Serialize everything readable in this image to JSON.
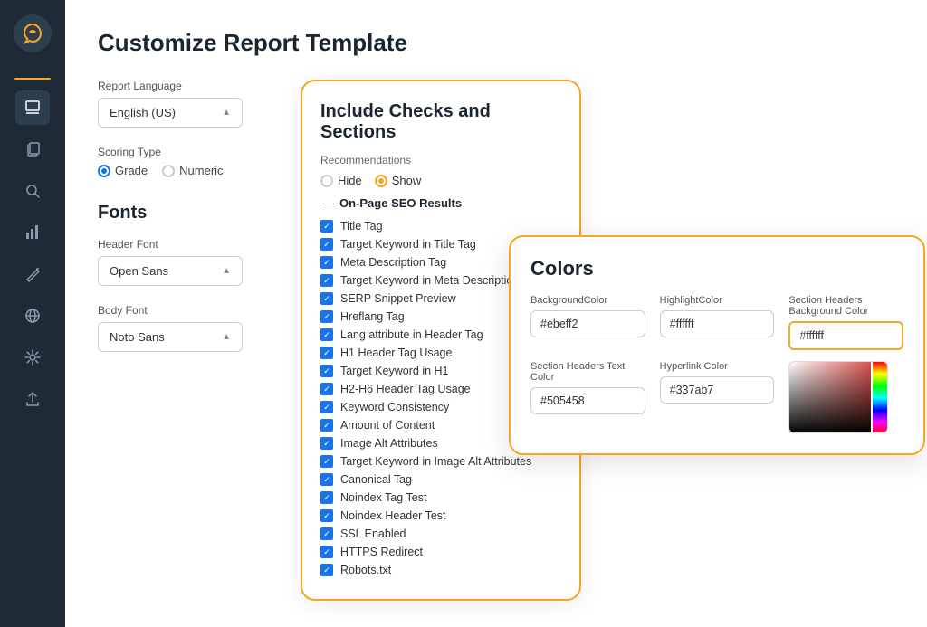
{
  "app": {
    "logo_symbol": "⟳",
    "page_title": "Customize Report Template"
  },
  "sidebar": {
    "icons": [
      {
        "name": "edit-icon",
        "symbol": "✎",
        "active": true
      },
      {
        "name": "copy-icon",
        "symbol": "⧉",
        "active": false
      },
      {
        "name": "search-icon",
        "symbol": "⌕",
        "active": false
      },
      {
        "name": "chart-icon",
        "symbol": "▦",
        "active": false
      },
      {
        "name": "tool-icon",
        "symbol": "⚒",
        "active": false
      },
      {
        "name": "globe-icon",
        "symbol": "🌐",
        "active": false
      },
      {
        "name": "settings-icon",
        "symbol": "⚙",
        "active": false
      },
      {
        "name": "upload-icon",
        "symbol": "⬆",
        "active": false
      }
    ]
  },
  "left_panel": {
    "report_language_label": "Report Language",
    "language_value": "English (US)",
    "scoring_type_label": "Scoring Type",
    "scoring_options": [
      {
        "label": "Grade",
        "selected": true
      },
      {
        "label": "Numeric",
        "selected": false
      }
    ],
    "fonts_title": "Fonts",
    "header_font_label": "Header Font",
    "header_font_value": "Open Sans",
    "body_font_label": "Body Font",
    "body_font_value": "Noto Sans"
  },
  "include_checks_card": {
    "title": "Include Checks and Sections",
    "recommendations_label": "Recommendations",
    "hide_label": "Hide",
    "show_label": "Show",
    "show_selected": true,
    "section_header": "On-Page SEO Results",
    "items": [
      "Title Tag",
      "Target Keyword in Title Tag",
      "Meta Description Tag",
      "Target Keyword in Meta Description",
      "SERP Snippet Preview",
      "Hreflang Tag",
      "Lang attribute in Header Tag",
      "H1 Header Tag Usage",
      "Target Keyword in H1",
      "H2-H6 Header Tag Usage",
      "Keyword Consistency",
      "Amount of Content",
      "Image Alt Attributes",
      "Target Keyword in Image Alt Attributes",
      "Canonical Tag",
      "Noindex Tag Test",
      "Noindex Header Test",
      "SSL Enabled",
      "HTTPS Redirect",
      "Robots.txt"
    ]
  },
  "colors_card": {
    "title": "Colors",
    "fields": [
      {
        "label": "BackgroundColor",
        "value": "#ebeff2"
      },
      {
        "label": "HighlightColor",
        "value": "#ffffff"
      },
      {
        "label": "Section Headers Background Color",
        "value": "#ffffff"
      },
      {
        "label": "Section Headers Text Color",
        "value": "#505458"
      },
      {
        "label": "Hyperlink Color",
        "value": "#337ab7"
      }
    ]
  }
}
